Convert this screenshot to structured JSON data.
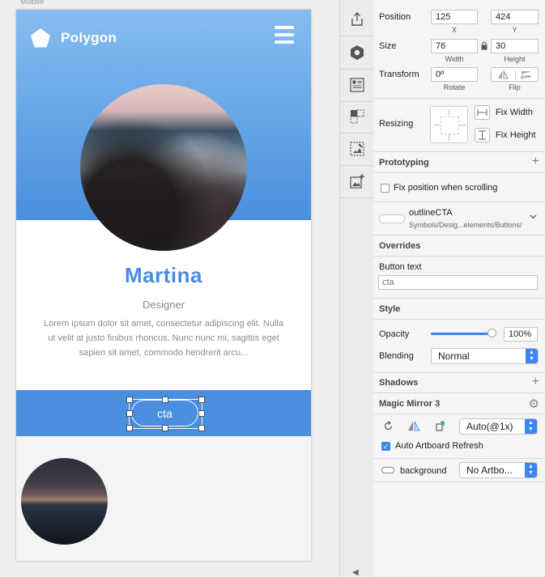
{
  "canvas": {
    "artboard_label": "Mobile",
    "brand": "Polygon",
    "profile": {
      "name": "Martina",
      "role": "Designer",
      "bio": "Lorem ipsum dolor sit amet, consectetur adipiscing elit. Nulla ut velit at justo finibus rhoncus. Nunc nunc mi, sagittis eget sapien sit amet, commodo hendrerit arcu..."
    },
    "cta_label": "cta",
    "colors": {
      "hero_top": "#85bdf0",
      "hero_bottom": "#4a8fde",
      "accent": "#4a8ee0",
      "name": "#4a8de0"
    }
  },
  "toolbar": {
    "icons": [
      "export-icon",
      "symbol-icon",
      "layout-icon",
      "mask-icon",
      "edit-image-icon",
      "insert-image-icon"
    ]
  },
  "inspector": {
    "position": {
      "label": "Position",
      "x": "125",
      "y": "424",
      "x_label": "X",
      "y_label": "Y"
    },
    "size": {
      "label": "Size",
      "width": "76",
      "height": "30",
      "width_label": "Width",
      "height_label": "Height"
    },
    "transform": {
      "label": "Transform",
      "rotate": "0º",
      "rotate_label": "Rotate",
      "flip_label": "Flip"
    },
    "resizing": {
      "label": "Resizing",
      "fix_width": "Fix Width",
      "fix_height": "Fix Height"
    },
    "prototyping": {
      "title": "Prototyping",
      "fix_position": "Fix position when scrolling"
    },
    "symbol": {
      "name": "outlineCTA",
      "path": "Symbols/Desig...elements/Buttons/"
    },
    "overrides": {
      "title": "Overrides",
      "button_text_label": "Button text",
      "button_text_placeholder": "cta"
    },
    "style": {
      "title": "Style",
      "opacity_label": "Opacity",
      "opacity_value": "100%",
      "opacity_fraction": 1.0,
      "blending_label": "Blending",
      "blending_value": "Normal"
    },
    "shadows": {
      "title": "Shadows"
    },
    "magic_mirror": {
      "title": "Magic Mirror 3",
      "scale_value": "Auto(@1x)",
      "auto_refresh": "Auto Artboard Refresh",
      "layer_label": "background",
      "artboard_value": "No Artbo..."
    }
  }
}
